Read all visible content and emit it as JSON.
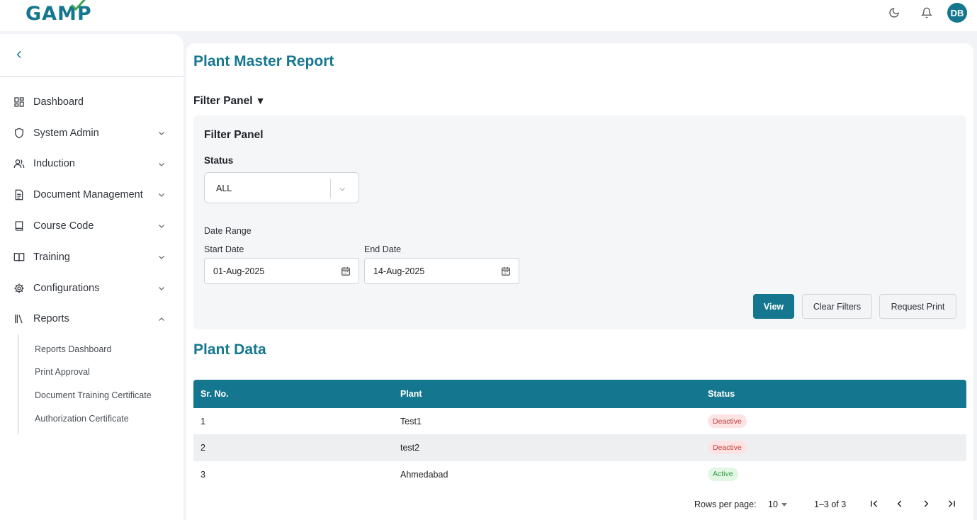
{
  "app": {
    "logo_text": "GAMP"
  },
  "header": {
    "avatar_initials": "DB"
  },
  "sidebar": {
    "items": [
      {
        "label": "Dashboard",
        "icon": "dashboard-grid-icon"
      },
      {
        "label": "System Admin",
        "icon": "shield-icon"
      },
      {
        "label": "Induction",
        "icon": "users-icon"
      },
      {
        "label": "Document Management",
        "icon": "document-icon"
      },
      {
        "label": "Course Code",
        "icon": "book-icon"
      },
      {
        "label": "Training",
        "icon": "open-book-icon"
      },
      {
        "label": "Configurations",
        "icon": "gear-icon"
      },
      {
        "label": "Reports",
        "icon": "library-icon"
      }
    ],
    "reports_sub": [
      {
        "label": "Reports Dashboard"
      },
      {
        "label": "Print Approval"
      },
      {
        "label": "Document Training Certificate"
      },
      {
        "label": "Authorization Certificate"
      }
    ]
  },
  "main": {
    "title": "Plant Master Report",
    "filter_toggle_label": "Filter Panel",
    "filter_toggle_symbol": "▼",
    "filter_panel": {
      "title": "Filter Panel",
      "status_label": "Status",
      "status_value": "ALL",
      "date_range_label": "Date Range",
      "start_label": "Start Date",
      "start_value": "01-Aug-2025",
      "end_label": "End Date",
      "end_value": "14-Aug-2025",
      "view_btn": "View",
      "clear_btn": "Clear Filters",
      "print_btn": "Request Print"
    },
    "data_title": "Plant Data",
    "table": {
      "columns": [
        "Sr. No.",
        "Plant",
        "Status"
      ],
      "rows": [
        {
          "sr": "1",
          "plant": "Test1",
          "status": "Deactive"
        },
        {
          "sr": "2",
          "plant": "test2",
          "status": "Deactive"
        },
        {
          "sr": "3",
          "plant": "Ahmedabad",
          "status": "Active"
        }
      ]
    },
    "pagination": {
      "rows_per_page_label": "Rows per page:",
      "rows_per_page": "10",
      "range": "1–3 of 3"
    }
  },
  "colors": {
    "accent": "#15778f",
    "deactive": "#c43b3b",
    "active": "#2f9a45"
  }
}
